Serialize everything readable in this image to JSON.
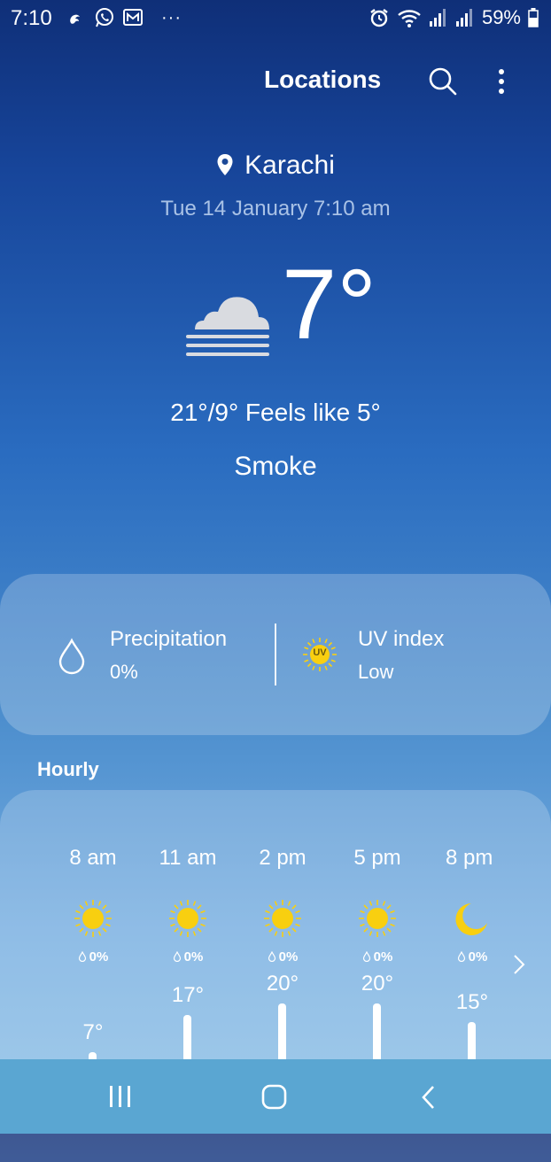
{
  "status_bar": {
    "time": "7:10",
    "more": "···",
    "battery": "59%"
  },
  "header": {
    "title": "Locations"
  },
  "location": {
    "city": "Karachi",
    "datetime": "Tue 14 January 7:10 am"
  },
  "current": {
    "temperature": "7°",
    "high_low_feels": "21°/9° Feels like 5°",
    "condition": "Smoke",
    "condition_icon": "fog-cloud-icon"
  },
  "details": {
    "precipitation_label": "Precipitation",
    "precipitation_value": "0%",
    "uv_label": "UV index",
    "uv_value": "Low",
    "uv_badge": "UV"
  },
  "hourly": {
    "label": "Hourly",
    "items": [
      {
        "time": "8 am",
        "icon": "sun-icon",
        "precip": "0%",
        "temp": "7°",
        "temp_value": 7
      },
      {
        "time": "11 am",
        "icon": "sun-icon",
        "precip": "0%",
        "temp": "17°",
        "temp_value": 17
      },
      {
        "time": "2 pm",
        "icon": "sun-icon",
        "precip": "0%",
        "temp": "20°",
        "temp_value": 20
      },
      {
        "time": "5 pm",
        "icon": "sun-icon",
        "precip": "0%",
        "temp": "20°",
        "temp_value": 20
      },
      {
        "time": "8 pm",
        "icon": "moon-icon",
        "precip": "0%",
        "temp": "15°",
        "temp_value": 15
      }
    ]
  },
  "colors": {
    "sun": "#f8cf10",
    "accent": "#ffffff"
  }
}
